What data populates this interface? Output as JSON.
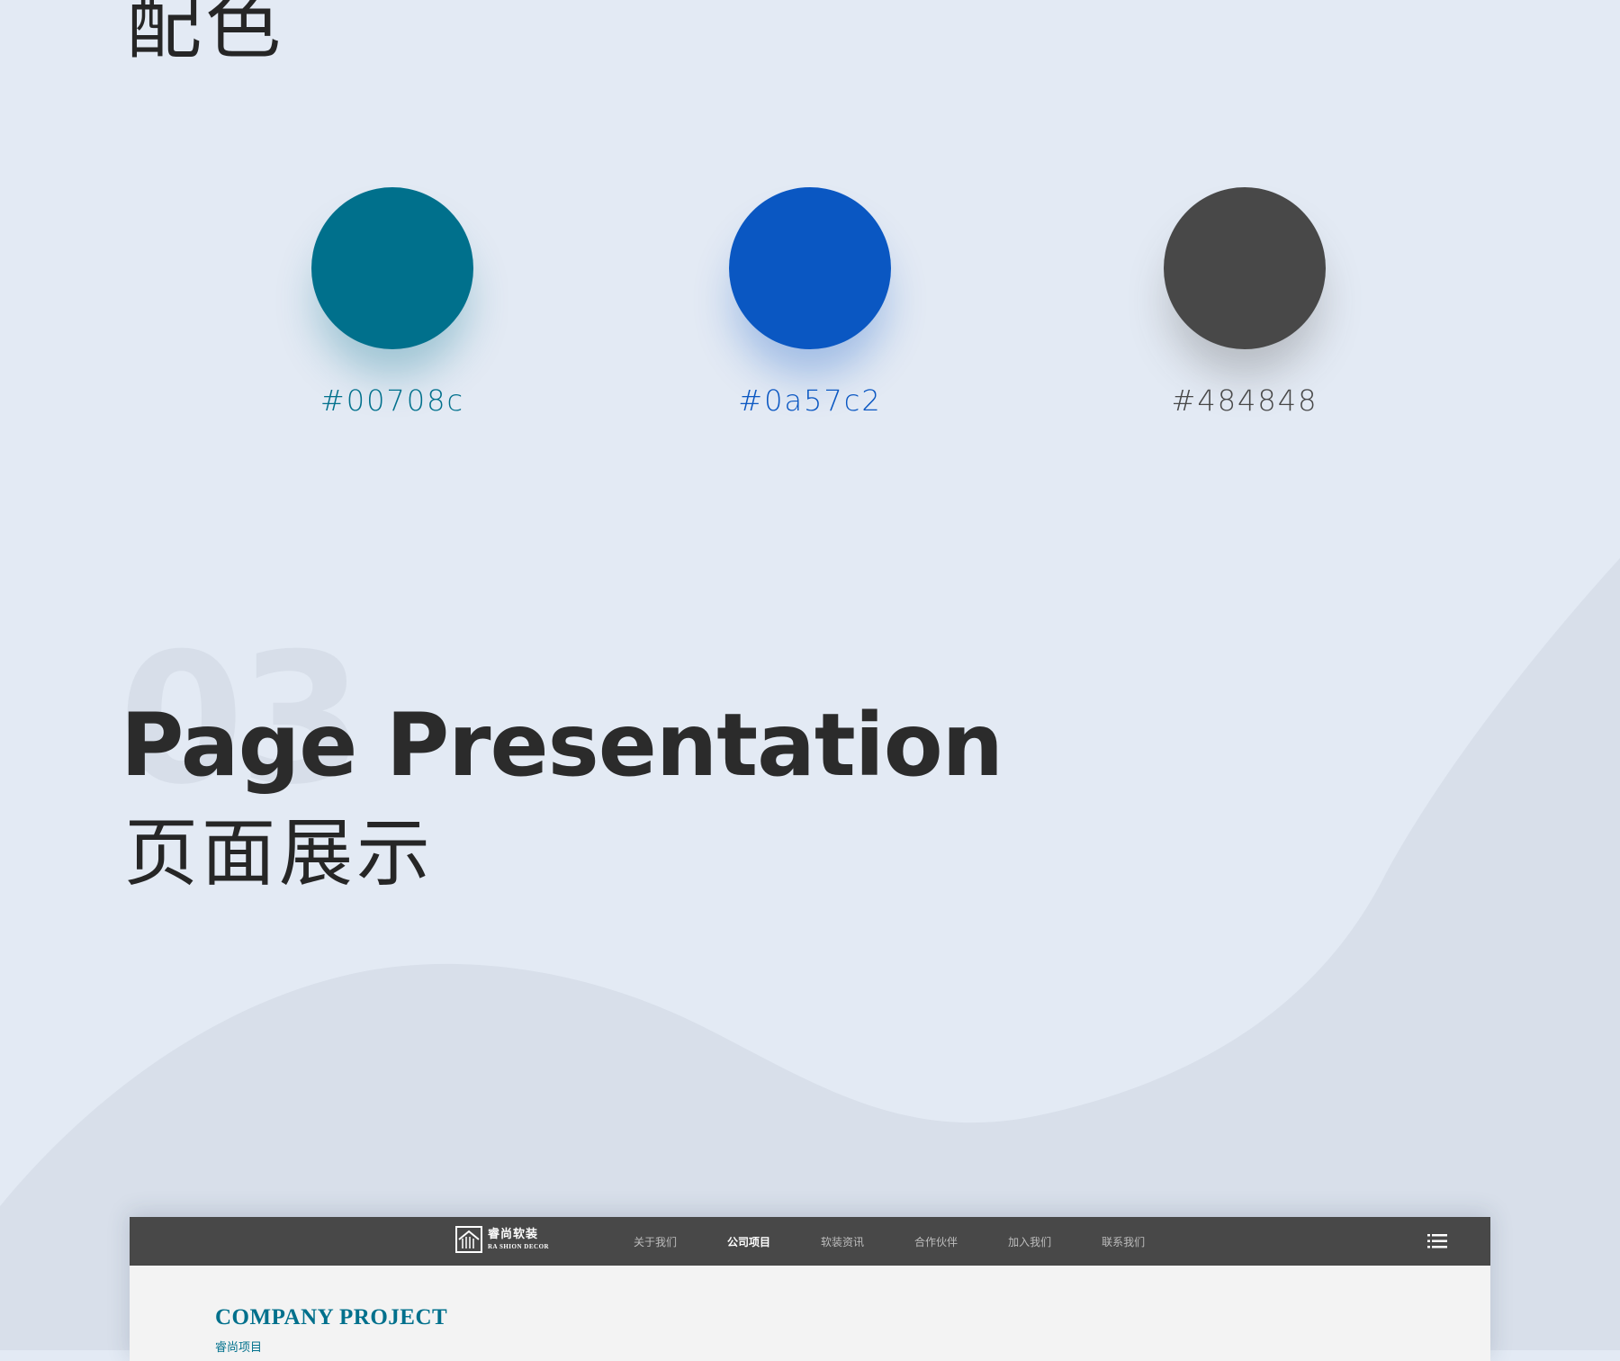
{
  "colors_section": {
    "title": "配色",
    "swatches": [
      {
        "hex": "#00708c",
        "label": "#00708c",
        "shadow": "rgba(0,112,140,0.30)"
      },
      {
        "hex": "#0a57c2",
        "label": "#0a57c2",
        "shadow": "rgba(10,87,194,0.30)"
      },
      {
        "hex": "#484848",
        "label": "#484848",
        "shadow": "rgba(72,72,72,0.28)"
      }
    ]
  },
  "presentation": {
    "number": "03",
    "title": "Page Presentation",
    "subtitle": "页面展示"
  },
  "preview": {
    "logo": {
      "cn": "睿尚软装",
      "en": "RA SHION DECOR",
      "icon": "house-logo-icon"
    },
    "nav": [
      {
        "label": "关于我们",
        "active": false
      },
      {
        "label": "公司项目",
        "active": true
      },
      {
        "label": "软装资讯",
        "active": false
      },
      {
        "label": "合作伙伴",
        "active": false
      },
      {
        "label": "加入我们",
        "active": false
      },
      {
        "label": "联系我们",
        "active": false
      }
    ],
    "menu_icon": "list-menu-icon",
    "heading": "COMPANY PROJECT",
    "subheading": "睿尚项目",
    "accent": "#00708c",
    "nav_bg": "#484848"
  },
  "page_bg": "#e3eaf4",
  "wave_color": "#d8dfea"
}
